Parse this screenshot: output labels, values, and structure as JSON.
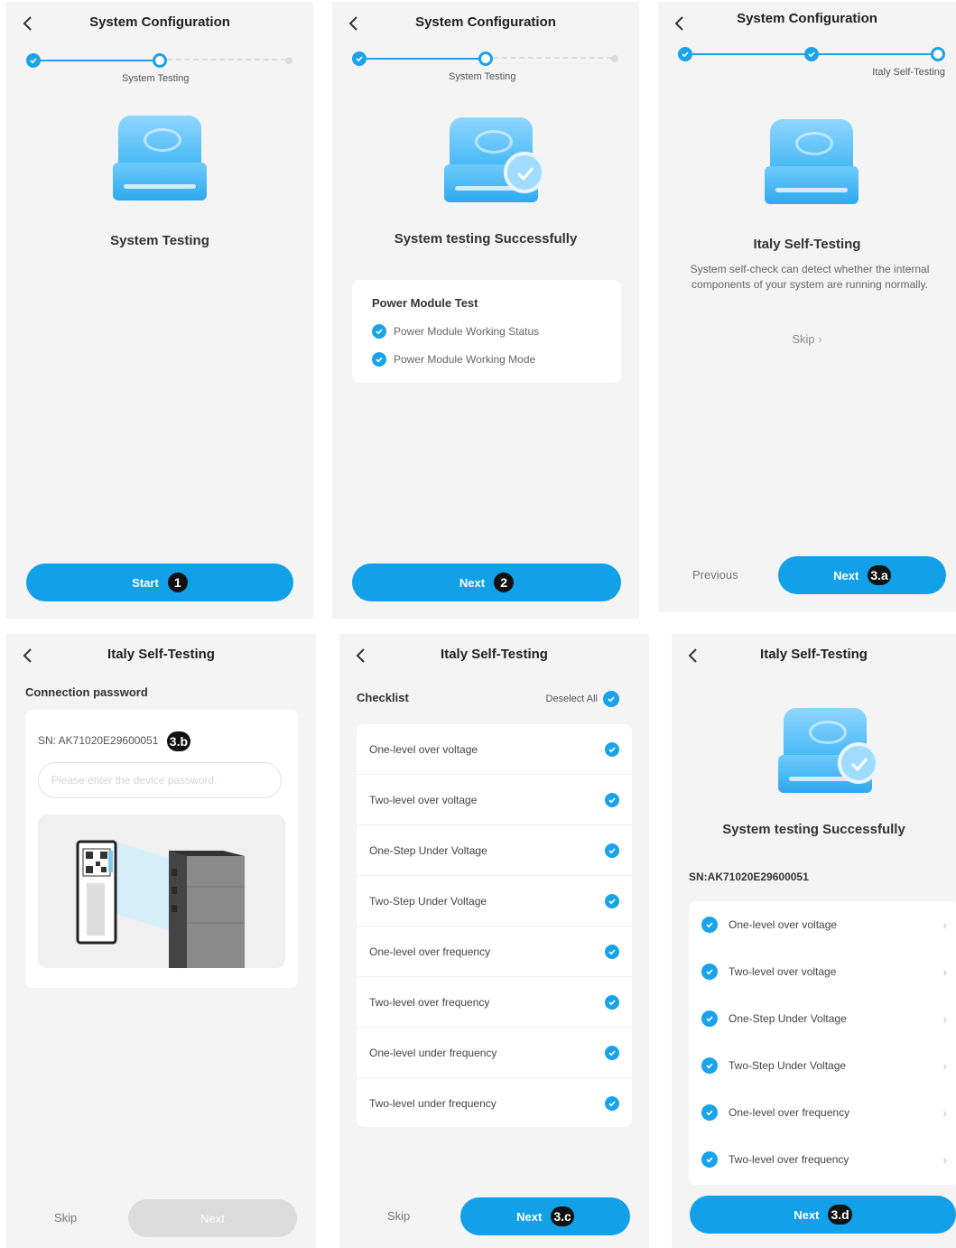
{
  "screens": {
    "s1": {
      "title": "System Configuration",
      "step_label": "System Testing",
      "heading": "System Testing",
      "button": "Start",
      "badge": "1"
    },
    "s2": {
      "title": "System Configuration",
      "step_label": "System Testing",
      "heading": "System testing Successfully",
      "card_title": "Power Module Test",
      "items": [
        "Power Module Working Status",
        "Power Module Working Mode"
      ],
      "button": "Next",
      "badge": "2"
    },
    "s3": {
      "title": "System Configuration",
      "step_label": "Italy Self-Testing",
      "heading": "Italy Self-Testing",
      "description": "System self-check can detect whether the internal components of your system are running normally.",
      "skip": "Skip",
      "previous": "Previous",
      "button": "Next",
      "badge": "3.a"
    },
    "s4": {
      "title": "Italy Self-Testing",
      "label": "Connection password",
      "sn": "SN: AK71020E29600051",
      "sn_badge": "3.b",
      "placeholder": "Please enter the device password.",
      "skip": "Skip",
      "button": "Next"
    },
    "s5": {
      "title": "Italy Self-Testing",
      "checklist_label": "Checklist",
      "deselect_label": "Deselect All",
      "items": [
        "One-level over voltage",
        "Two-level over voltage",
        "One-Step Under Voltage",
        "Two-Step Under Voltage",
        "One-level over frequency",
        "Two-level over frequency",
        "One-level under frequency",
        "Two-level under frequency"
      ],
      "skip": "Skip",
      "button": "Next",
      "badge": "3.c"
    },
    "s6": {
      "title": "Italy Self-Testing",
      "heading": "System testing Successfully",
      "sn": "SN:AK71020E29600051",
      "items": [
        "One-level over voltage",
        "Two-level over voltage",
        "One-Step Under Voltage",
        "Two-Step Under Voltage",
        "One-level over frequency",
        "Two-level over frequency"
      ],
      "button": "Next",
      "badge": "3.d"
    }
  },
  "colors": {
    "accent": "#12a0e8",
    "panel_bg": "#f4f4f4",
    "disabled": "#dcdcdc"
  }
}
